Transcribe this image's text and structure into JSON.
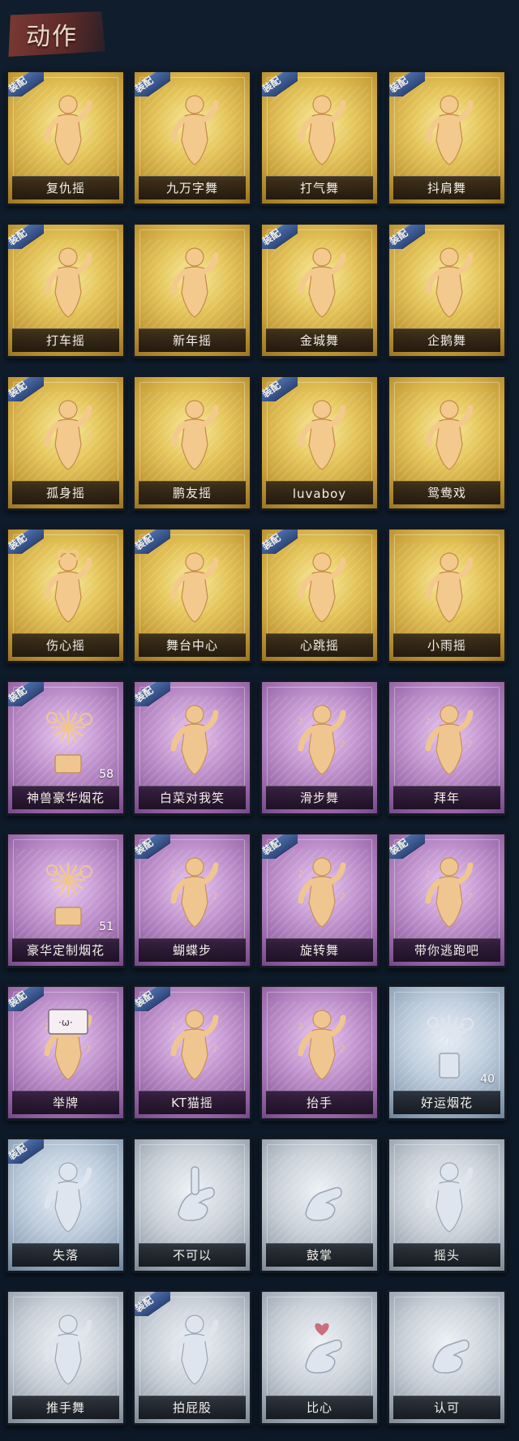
{
  "header": {
    "title": "动作"
  },
  "equip_label": "装配",
  "colors": {
    "gold": "#e5c65b",
    "purple": "#c093cd",
    "silver": "#c9d0d8",
    "blue": "#bccbdb",
    "equip_ribbon": "#3b5894",
    "background": "#0e1b2a"
  },
  "cards": [
    {
      "name": "复仇摇",
      "tier": "gold",
      "equipped": true,
      "icon": "dance-figure-icon"
    },
    {
      "name": "九万字舞",
      "tier": "gold",
      "equipped": true,
      "icon": "dance-figure-icon"
    },
    {
      "name": "打气舞",
      "tier": "gold",
      "equipped": true,
      "icon": "dance-figure-icon"
    },
    {
      "name": "抖肩舞",
      "tier": "gold",
      "equipped": true,
      "icon": "dance-figure-icon"
    },
    {
      "name": "打车摇",
      "tier": "gold",
      "equipped": true,
      "icon": "dance-figure-icon"
    },
    {
      "name": "新年摇",
      "tier": "gold",
      "equipped": false,
      "icon": "dance-figure-icon"
    },
    {
      "name": "金城舞",
      "tier": "gold",
      "equipped": true,
      "icon": "dance-figure-icon"
    },
    {
      "name": "企鹅舞",
      "tier": "gold",
      "equipped": true,
      "icon": "dance-figure-icon"
    },
    {
      "name": "孤身摇",
      "tier": "gold",
      "equipped": true,
      "icon": "dance-figure-icon"
    },
    {
      "name": "鹏友摇",
      "tier": "gold",
      "equipped": false,
      "icon": "dance-figure-icon"
    },
    {
      "name": "luvaboy",
      "tier": "gold",
      "equipped": true,
      "icon": "dance-figure-icon"
    },
    {
      "name": "鸳鸯戏",
      "tier": "gold",
      "equipped": false,
      "icon": "dance-figure-icon"
    },
    {
      "name": "伤心摇",
      "tier": "gold",
      "equipped": true,
      "icon": "heart-hands-figure-icon"
    },
    {
      "name": "舞台中心",
      "tier": "gold",
      "equipped": true,
      "icon": "dance-figure-icon"
    },
    {
      "name": "心跳摇",
      "tier": "gold",
      "equipped": true,
      "icon": "dance-figure-icon"
    },
    {
      "name": "小雨摇",
      "tier": "gold",
      "equipped": false,
      "icon": "dance-figure-icon"
    },
    {
      "name": "神兽豪华烟花",
      "tier": "purple",
      "equipped": true,
      "icon": "fireworks-icon",
      "count": "58"
    },
    {
      "name": "白菜对我笑",
      "tier": "purple",
      "equipped": true,
      "icon": "dance-figure-icon"
    },
    {
      "name": "滑步舞",
      "tier": "purple",
      "equipped": false,
      "icon": "dance-figure-icon"
    },
    {
      "name": "拜年",
      "tier": "purple",
      "equipped": false,
      "icon": "bow-figure-icon"
    },
    {
      "name": "豪华定制烟花",
      "tier": "purple",
      "equipped": false,
      "icon": "fireworks-box-icon",
      "count": "51"
    },
    {
      "name": "蝴蝶步",
      "tier": "purple",
      "equipped": true,
      "icon": "dance-figure-icon"
    },
    {
      "name": "旋转舞",
      "tier": "purple",
      "equipped": true,
      "icon": "spin-figure-icon"
    },
    {
      "name": "带你逃跑吧",
      "tier": "purple",
      "equipped": true,
      "icon": "dance-figure-icon"
    },
    {
      "name": "举牌",
      "tier": "purple",
      "equipped": true,
      "icon": "sign-holding-figure-icon"
    },
    {
      "name": "KT猫摇",
      "tier": "purple",
      "equipped": true,
      "icon": "dance-figure-icon"
    },
    {
      "name": "抬手",
      "tier": "purple",
      "equipped": false,
      "icon": "raise-hand-figure-icon"
    },
    {
      "name": "好运烟花",
      "tier": "blue",
      "equipped": false,
      "icon": "firework-can-icon",
      "count": "40"
    },
    {
      "name": "失落",
      "tier": "blue",
      "equipped": true,
      "icon": "crawl-figure-icon"
    },
    {
      "name": "不可以",
      "tier": "silver",
      "equipped": false,
      "icon": "finger-no-icon"
    },
    {
      "name": "鼓掌",
      "tier": "silver",
      "equipped": false,
      "icon": "clap-hands-icon"
    },
    {
      "name": "摇头",
      "tier": "silver",
      "equipped": false,
      "icon": "shake-head-figure-icon"
    },
    {
      "name": "推手舞",
      "tier": "silver",
      "equipped": false,
      "icon": "push-hands-figure-icon"
    },
    {
      "name": "拍屁股",
      "tier": "silver",
      "equipped": true,
      "icon": "pat-figure-icon"
    },
    {
      "name": "比心",
      "tier": "silver",
      "equipped": false,
      "icon": "finger-heart-icon"
    },
    {
      "name": "认可",
      "tier": "silver",
      "equipped": false,
      "icon": "thumbs-up-icon"
    }
  ]
}
